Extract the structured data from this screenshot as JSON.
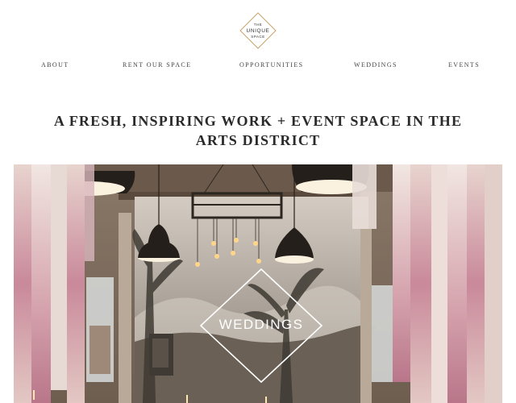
{
  "logo": {
    "line1": "THE",
    "line2": "UNIQUE",
    "line3": "SPACE"
  },
  "nav": {
    "about": "ABOUT",
    "rent": "RENT OUR SPACE",
    "opportunities": "OPPORTUNITIES",
    "weddings": "WEDDINGS",
    "events": "EVENTS"
  },
  "headline": "A FRESH, INSPIRING WORK + EVENT SPACE IN THE ARTS DISTRICT",
  "hero": {
    "badge_label": "WEDDINGS"
  },
  "colors": {
    "logo_gold": "#c9a46a",
    "text": "#2a2a2a",
    "badge_line": "#ffffff"
  }
}
